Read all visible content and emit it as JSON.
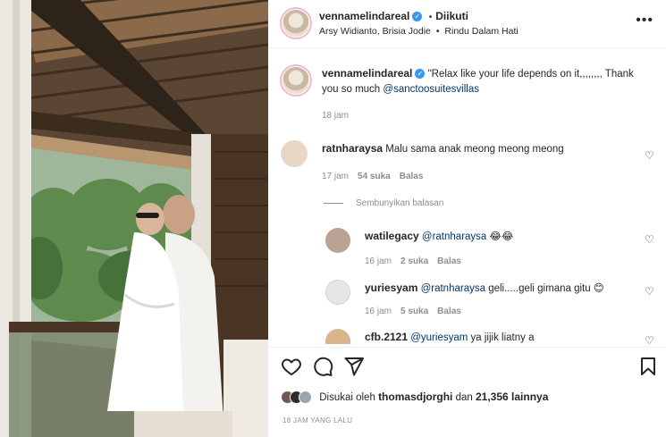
{
  "header": {
    "username": "vennamelindareal",
    "verified_mark": "✓",
    "separator": "•",
    "follow_status": "Diikuti",
    "tagged": "Arsy Widianto, Brisia Jodie",
    "audio": "Rindu Dalam Hati",
    "more_icon": "more-horizontal-icon"
  },
  "caption": {
    "username": "vennamelindareal",
    "text": "\"Relax like your life depends on it,,,,,,,, Thank you so much",
    "mention": "@sanctoosuitesvillas",
    "time": "18 jam"
  },
  "comments": [
    {
      "username": "ratnharaysa",
      "text": "Malu sama anak meong meong meong",
      "time": "17 jam",
      "likes": "54 suka",
      "reply": "Balas"
    }
  ],
  "hide_replies": "Sembunyikan balasan",
  "replies": [
    {
      "username": "watilegacy",
      "mention": "@ratnharaysa",
      "text": "😂😂",
      "time": "16 jam",
      "likes": "2 suka",
      "reply": "Balas"
    },
    {
      "username": "yuriesyam",
      "mention": "@ratnharaysa",
      "text": "geli.....geli gimana gitu 😊",
      "time": "16 jam",
      "likes": "5 suka",
      "reply": "Balas"
    },
    {
      "username": "cfb.2121",
      "mention": "@yuriesyam",
      "text": "ya jijik liatny a",
      "time": "",
      "likes": "",
      "reply": ""
    }
  ],
  "actions": {
    "like_icon": "heart-icon",
    "comment_icon": "comment-icon",
    "share_icon": "send-icon",
    "save_icon": "bookmark-icon"
  },
  "likes": {
    "prefix": "Disukai oleh",
    "user": "thomasdjorghi",
    "middle": "dan",
    "count": "21,356 lainnya"
  },
  "time_ago": "18 JAM YANG LALU",
  "colors": {
    "link": "#00376b",
    "verified": "#3897f0",
    "muted": "#8e8e8e"
  }
}
